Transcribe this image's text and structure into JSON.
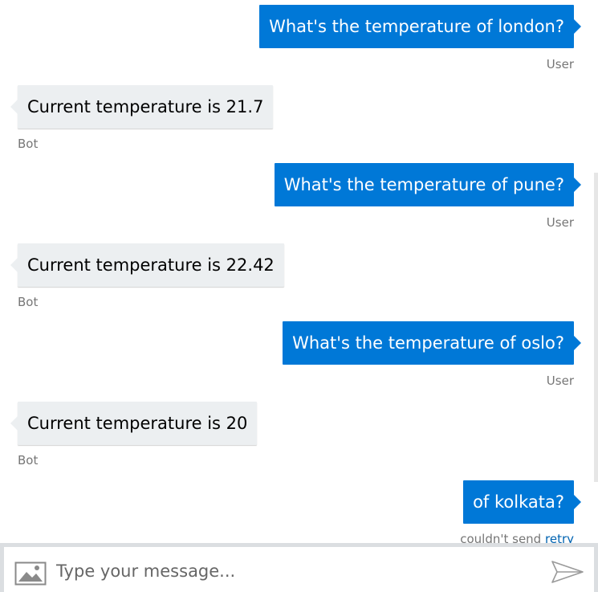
{
  "messages": [
    {
      "from": "user",
      "text": "What's the temperature of london?",
      "sender": "User"
    },
    {
      "from": "bot",
      "text": "Current temperature is 21.7",
      "sender": "Bot"
    },
    {
      "from": "user",
      "text": "What's the temperature of pune?",
      "sender": "User"
    },
    {
      "from": "bot",
      "text": "Current temperature is 22.42",
      "sender": "Bot"
    },
    {
      "from": "user",
      "text": "What's the temperature of oslo?",
      "sender": "User"
    },
    {
      "from": "bot",
      "text": "Current temperature is 20",
      "sender": "Bot"
    },
    {
      "from": "user",
      "text": "of kolkata?",
      "status": "couldn't send",
      "retry": "retry"
    }
  ],
  "composer": {
    "placeholder": "Type your message...",
    "image_icon": "image-icon",
    "send_icon": "send-icon"
  },
  "colors": {
    "user_bubble": "#0078d7",
    "bot_bubble": "#eceff1",
    "link": "#0063b1"
  }
}
